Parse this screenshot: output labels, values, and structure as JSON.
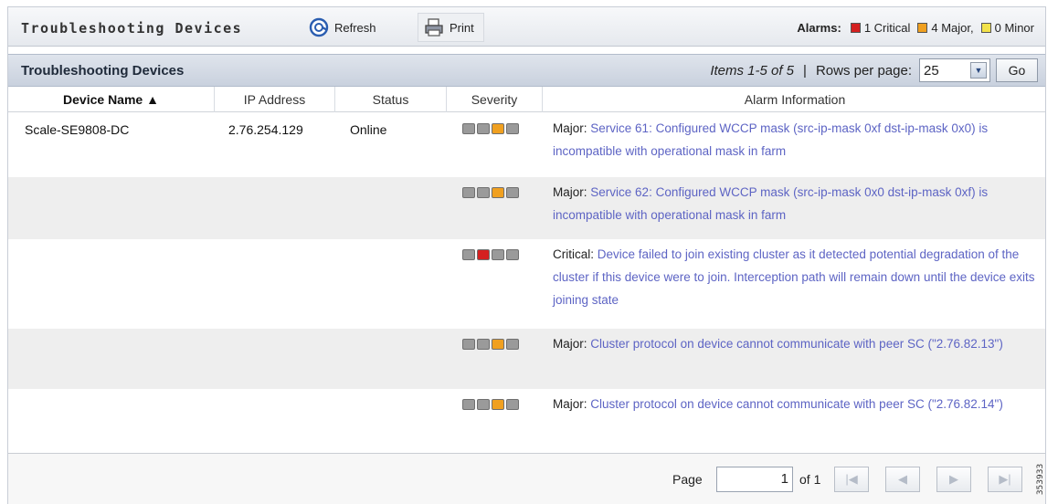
{
  "toolbar": {
    "title": "Troubleshooting Devices",
    "refresh_label": "Refresh",
    "print_label": "Print",
    "alarms_label": "Alarms:",
    "critical_text": "1 Critical",
    "major_text": "4 Major,",
    "minor_text": "0 Minor",
    "icons": {
      "refresh": "refresh-icon",
      "print": "printer-icon"
    }
  },
  "colors": {
    "critical": "#d42020",
    "major": "#f0a020",
    "minor": "#f2e24a",
    "link": "#5d64c4",
    "severity_off": "#9a9a9a"
  },
  "table": {
    "title": "Troubleshooting Devices",
    "items_text": "Items 1-5 of 5",
    "separator": "|",
    "rows_per_page_label": "Rows per page:",
    "rows_per_page_value": "25",
    "go_label": "Go",
    "columns": [
      "Device Name ▲",
      "IP Address",
      "Status",
      "Severity",
      "Alarm Information"
    ],
    "rows": [
      {
        "device": "Scale-SE9808-DC",
        "ip": "2.76.254.129",
        "status": "Online",
        "severity_level": "major",
        "alarm_severity": "Major:",
        "alarm_message": "Service 61: Configured WCCP mask (src-ip-mask 0xf dst-ip-mask 0x0) is incompatible with operational mask in farm"
      },
      {
        "device": "",
        "ip": "",
        "status": "",
        "severity_level": "major",
        "alarm_severity": "Major:",
        "alarm_message": "Service 62: Configured WCCP mask (src-ip-mask 0x0 dst-ip-mask 0xf) is incompatible with operational mask in farm"
      },
      {
        "device": "",
        "ip": "",
        "status": "",
        "severity_level": "critical",
        "alarm_severity": "Critical:",
        "alarm_message": "Device failed to join existing cluster as it detected potential degradation of the cluster if this device were to join. Interception path will remain down until the device exits joining state"
      },
      {
        "device": "",
        "ip": "",
        "status": "",
        "severity_level": "major",
        "alarm_severity": "Major:",
        "alarm_message": "Cluster protocol on device cannot communicate with peer SC (\"2.76.82.13\")"
      },
      {
        "device": "",
        "ip": "",
        "status": "",
        "severity_level": "major",
        "alarm_severity": "Major:",
        "alarm_message": "Cluster protocol on device cannot communicate with peer SC (\"2.76.82.14\")"
      }
    ]
  },
  "pagination": {
    "page_label": "Page",
    "page_value": "1",
    "of_text": "of 1",
    "first_glyph": "|◀",
    "prev_glyph": "◀",
    "next_glyph": "▶",
    "last_glyph": "▶|"
  },
  "figure_number": "353933"
}
